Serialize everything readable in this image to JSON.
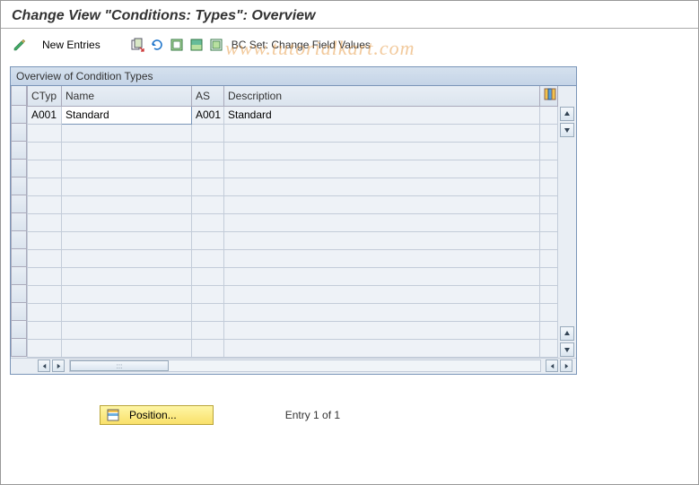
{
  "title": "Change View \"Conditions: Types\": Overview",
  "toolbar": {
    "new_entries": "New Entries",
    "bc_set_label": "BC Set: Change Field Values"
  },
  "panel": {
    "header": "Overview of Condition Types",
    "columns": {
      "ctyp": "CTyp",
      "name": "Name",
      "as": "AS",
      "desc": "Description"
    }
  },
  "rows": [
    {
      "ctyp": "A001",
      "name": "Standard",
      "as": "A001",
      "desc": "Standard"
    }
  ],
  "footer": {
    "position_label": "Position...",
    "entry_status": "Entry 1 of 1"
  }
}
